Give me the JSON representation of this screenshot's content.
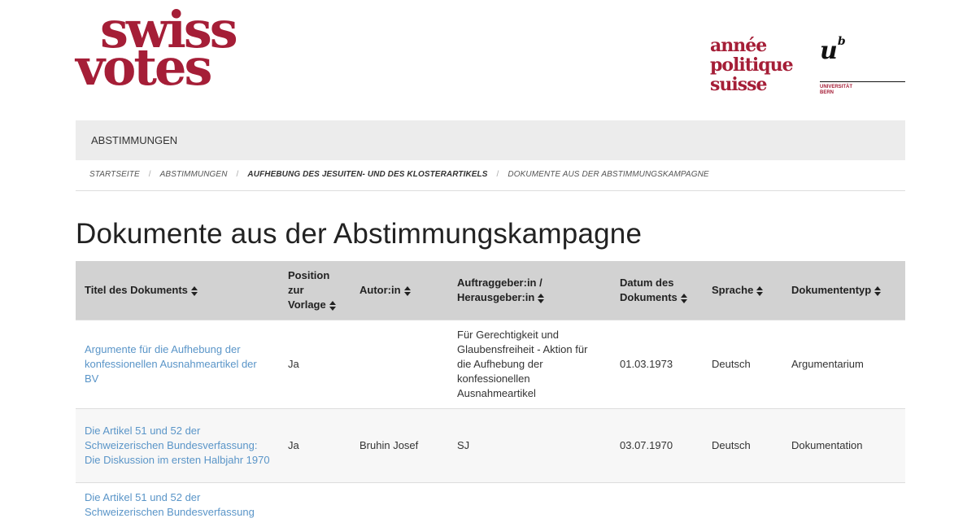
{
  "logo": {
    "line1": "swiss",
    "line2": "votes"
  },
  "aps_logo": {
    "line1": "année",
    "line2": "politique",
    "line3": "suisse"
  },
  "unibe_logo": {
    "mark": "u",
    "sup": "b",
    "line1": "UNIVERSITÄT",
    "line2": "BERN"
  },
  "nav": {
    "item1": "ABSTIMMUNGEN"
  },
  "breadcrumb": [
    "STARTSEITE",
    "ABSTIMMUNGEN",
    "AUFHEBUNG DES JESUITEN- UND DES KLOSTERARTIKELS",
    "DOKUMENTE AUS DER ABSTIMMUNGSKAMPAGNE"
  ],
  "page_title": "Dokumente aus der Abstimmungskampagne",
  "table": {
    "headers": [
      "Titel des Dokuments",
      "Position zur Vorlage",
      "Autor:in",
      "Auftraggeber:in / Herausgeber:in",
      "Datum des Dokuments",
      "Sprache",
      "Dokumententyp"
    ],
    "rows": [
      [
        "Argumente für die Aufhebung der konfessionellen Ausnahmeartikel der BV",
        "Ja",
        "",
        "Für Gerechtigkeit und Glaubensfreiheit - Aktion für die Aufhebung der konfessionellen Ausnahmeartikel",
        "01.03.1973",
        "Deutsch",
        "Argumentarium"
      ],
      [
        "Die Artikel 51 und 52 der Schweizerischen Bundesverfassung: Die Diskussion im ersten Halbjahr 1970",
        "Ja",
        "Bruhin Josef",
        "SJ",
        "03.07.1970",
        "Deutsch",
        "Dokumentation"
      ],
      [
        "Die Artikel 51 und 52 der Schweizerischen Bundesverfassung",
        "",
        "",
        "",
        "",
        "",
        ""
      ]
    ]
  },
  "colors": {
    "brand": "#a51e37",
    "link": "#5a95c8",
    "header_bg": "#d2d2d2",
    "nav_bg": "#ececec"
  },
  "icons": {
    "sort": "sort-icon"
  }
}
